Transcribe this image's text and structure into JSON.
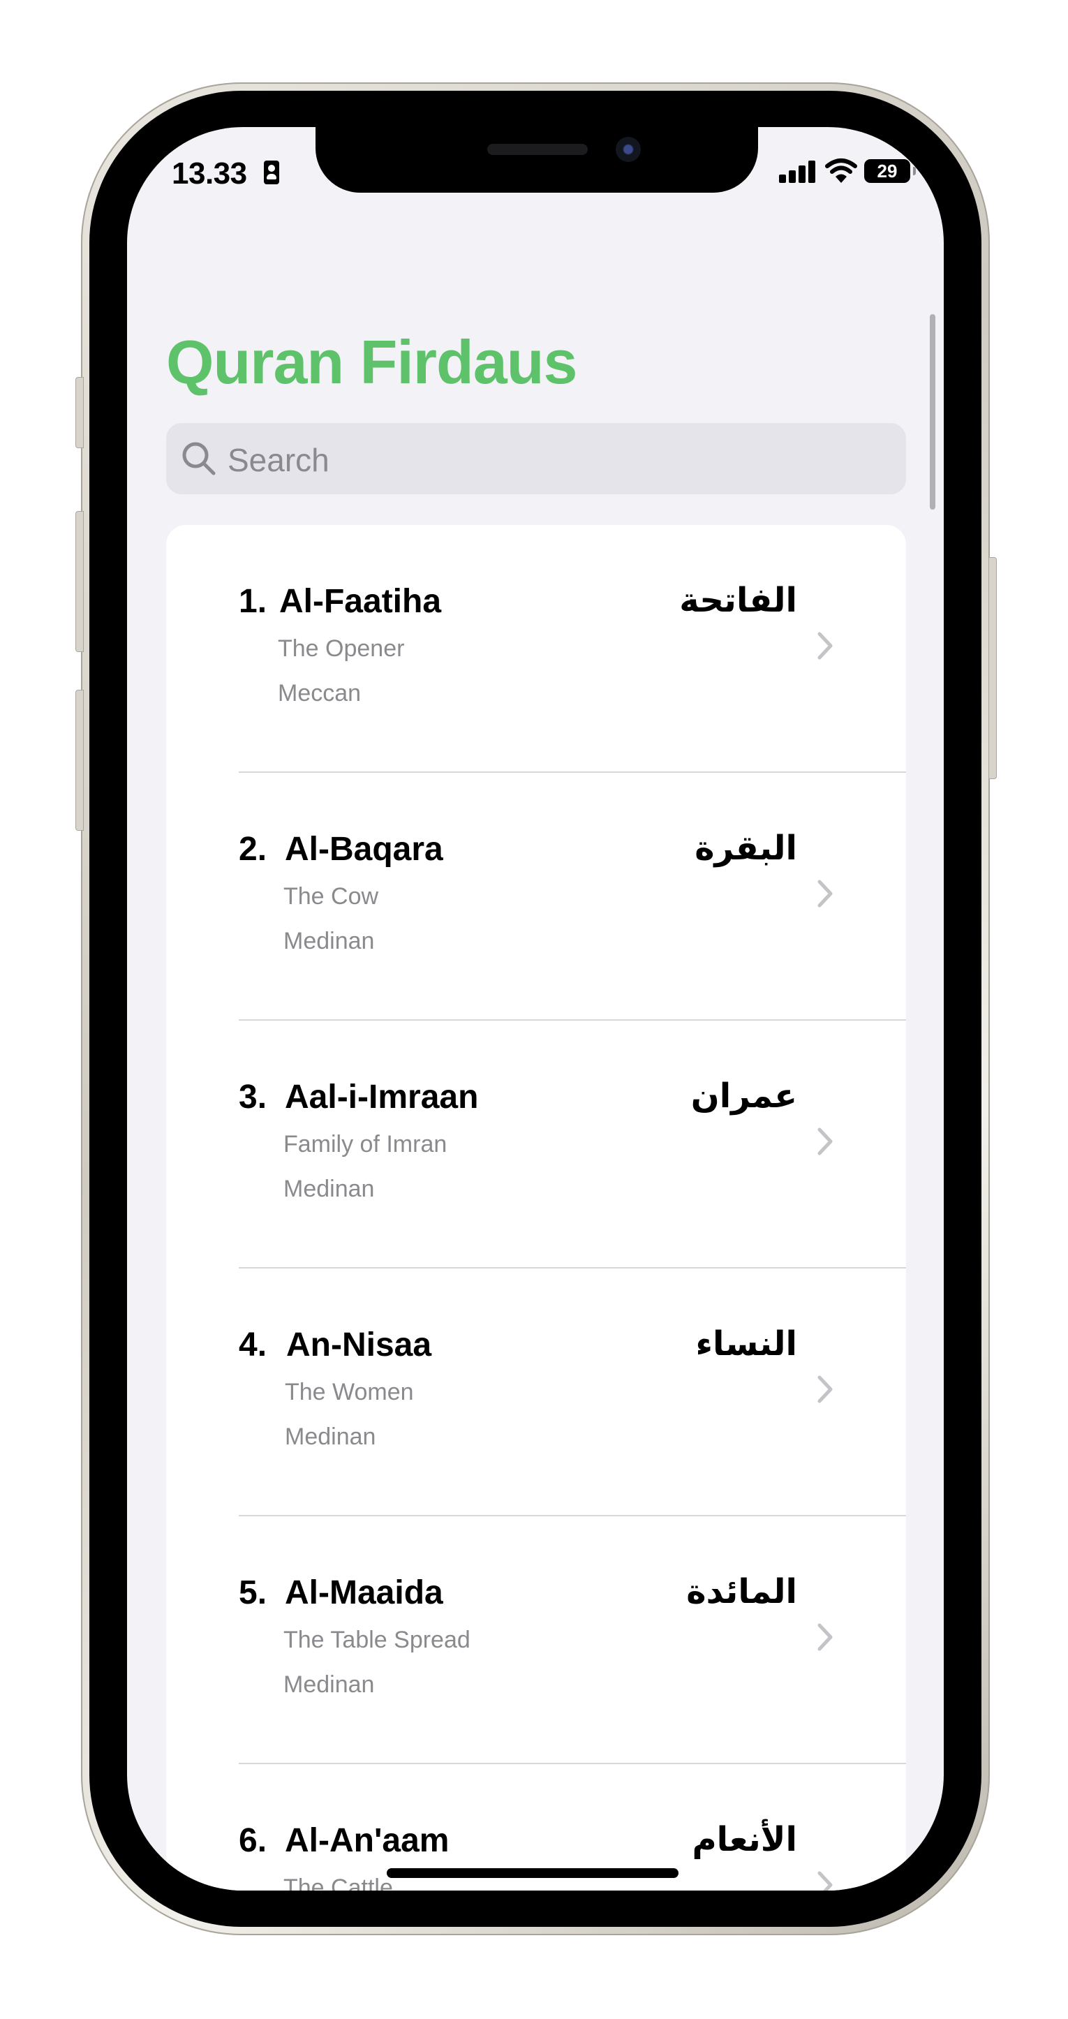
{
  "status_bar": {
    "time": "13.33",
    "battery_level": "29"
  },
  "app": {
    "title": "Quran Firdaus",
    "accent_color": "#5ec26a"
  },
  "search": {
    "placeholder": "Search"
  },
  "surahs": [
    {
      "number": "1.",
      "name": "Al-Faatiha",
      "arabic": "الفاتحة",
      "meaning": "The Opener",
      "place": "Meccan"
    },
    {
      "number": "2.",
      "name": "Al-Baqara",
      "arabic": "البقرة",
      "meaning": "The Cow",
      "place": "Medinan"
    },
    {
      "number": "3.",
      "name": "Aal-i-Imraan",
      "arabic": "عمران",
      "meaning": "Family of Imran",
      "place": "Medinan"
    },
    {
      "number": "4.",
      "name": "An-Nisaa",
      "arabic": "النساء",
      "meaning": "The Women",
      "place": "Medinan"
    },
    {
      "number": "5.",
      "name": "Al-Maaida",
      "arabic": "المائدة",
      "meaning": "The Table Spread",
      "place": "Medinan"
    },
    {
      "number": "6.",
      "name": "Al-An'aam",
      "arabic": "الأنعام",
      "meaning": "The Cattle",
      "place": ""
    }
  ]
}
